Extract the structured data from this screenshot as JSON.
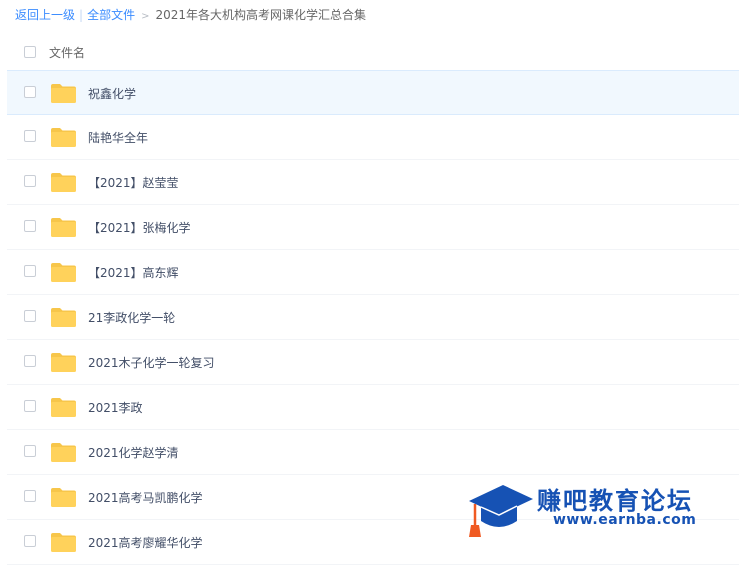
{
  "breadcrumb": {
    "back": "返回上一级",
    "separator": "|",
    "all_files": "全部文件",
    "arrow": ">",
    "current": "2021年各大机构高考网课化学汇总合集"
  },
  "header": {
    "name_column": "文件名"
  },
  "files": [
    {
      "name": "祝鑫化学",
      "icon": "folder-icon"
    },
    {
      "name": "陆艳华全年",
      "icon": "folder-icon"
    },
    {
      "name": "【2021】赵莹莹",
      "icon": "folder-icon"
    },
    {
      "name": "【2021】张梅化学",
      "icon": "folder-icon"
    },
    {
      "name": "【2021】高东辉",
      "icon": "folder-icon"
    },
    {
      "name": "21李政化学一轮",
      "icon": "folder-icon"
    },
    {
      "name": "2021木子化学一轮复习",
      "icon": "folder-icon"
    },
    {
      "name": "2021李政",
      "icon": "folder-icon"
    },
    {
      "name": "2021化学赵学清",
      "icon": "folder-icon"
    },
    {
      "name": "2021高考马凯鹏化学",
      "icon": "folder-icon"
    },
    {
      "name": "2021高考廖耀华化学",
      "icon": "folder-icon"
    }
  ],
  "watermark": {
    "name": "赚吧教育论坛",
    "url": "www.earnba.com",
    "icon": "graduation-cap-icon"
  },
  "colors": {
    "link": "#3b8cff",
    "folder": "#ffd25b",
    "row_hover": "#f1f8fe",
    "watermark": "#1652b4"
  }
}
